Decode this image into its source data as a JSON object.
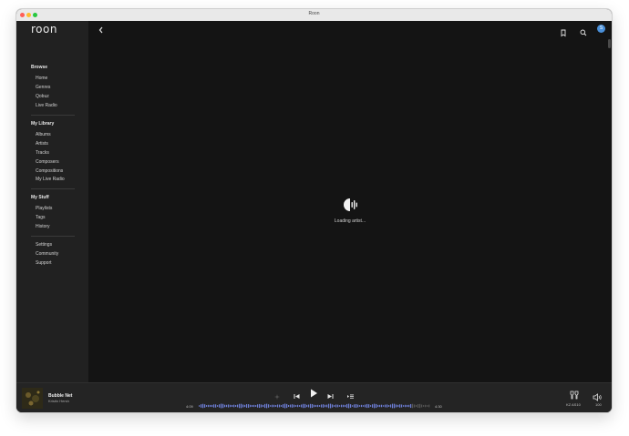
{
  "window": {
    "title": "Roon"
  },
  "app": {
    "logo": "roon"
  },
  "sidebar": {
    "browse": {
      "title": "Browse",
      "items": [
        "Home",
        "Genres",
        "Qobuz",
        "Live Radio"
      ]
    },
    "library": {
      "title": "My Library",
      "items": [
        "Albums",
        "Artists",
        "Tracks",
        "Composers",
        "Compositions",
        "My Live Radio"
      ]
    },
    "stuff": {
      "title": "My Stuff",
      "items": [
        "Playlists",
        "Tags",
        "History"
      ]
    },
    "misc": {
      "items": [
        "Settings",
        "Community",
        "Support"
      ]
    }
  },
  "topbar": {
    "icons": [
      "back-icon",
      "bookmark-icon",
      "search-icon"
    ],
    "avatar_initial": "S"
  },
  "main": {
    "status_text": "Loading artist..."
  },
  "player": {
    "track_title": "Bubble Net",
    "track_artist": "Kristin Hersh",
    "elapsed": "4:09",
    "duration": "4:30",
    "progress": 0.92,
    "zone_name": "KZ AS10",
    "volume": "100",
    "accent_color": "#6e7fd8"
  }
}
